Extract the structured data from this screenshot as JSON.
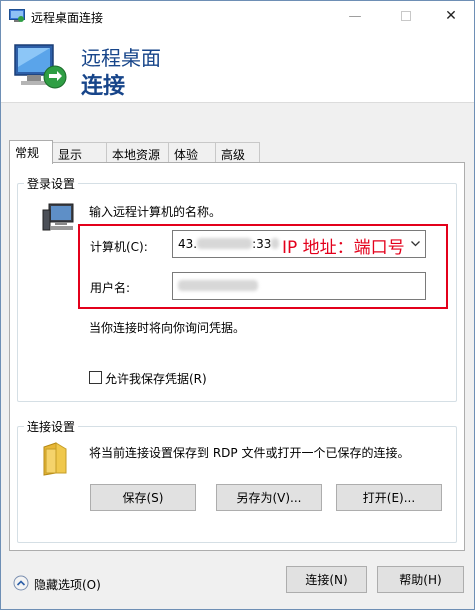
{
  "window": {
    "title": "远程桌面连接",
    "controls": {
      "minimize": "—",
      "close": "✕"
    }
  },
  "header": {
    "line1": "远程桌面",
    "line2": "连接"
  },
  "tabs": [
    {
      "label": "常规",
      "active": true
    },
    {
      "label": "显示",
      "active": false
    },
    {
      "label": "本地资源",
      "active": false
    },
    {
      "label": "体验",
      "active": false
    },
    {
      "label": "高级",
      "active": false
    }
  ],
  "login": {
    "group_label": "登录设置",
    "prompt": "输入远程计算机的名称。",
    "computer_label": "计算机(C):",
    "computer_value_prefix": "43.",
    "computer_value_mid": ":33",
    "username_label": "用户名:",
    "annotation": "IP 地址：端口号",
    "credential_note": "当你连接时将向你询问凭据。",
    "save_credentials_label": "允许我保存凭据(R)",
    "save_credentials_checked": false
  },
  "connection": {
    "group_label": "连接设置",
    "description": "将当前连接设置保存到 RDP 文件或打开一个已保存的连接。",
    "save_button": "保存(S)",
    "save_as_button": "另存为(V)...",
    "open_button": "打开(E)..."
  },
  "footer": {
    "hide_options": "隐藏选项(O)",
    "connect_button": "连接(N)",
    "help_button": "帮助(H)"
  },
  "colors": {
    "header_text": "#17458a",
    "annotation_red": "#e3001b",
    "button_bg": "#e1e1e1"
  }
}
